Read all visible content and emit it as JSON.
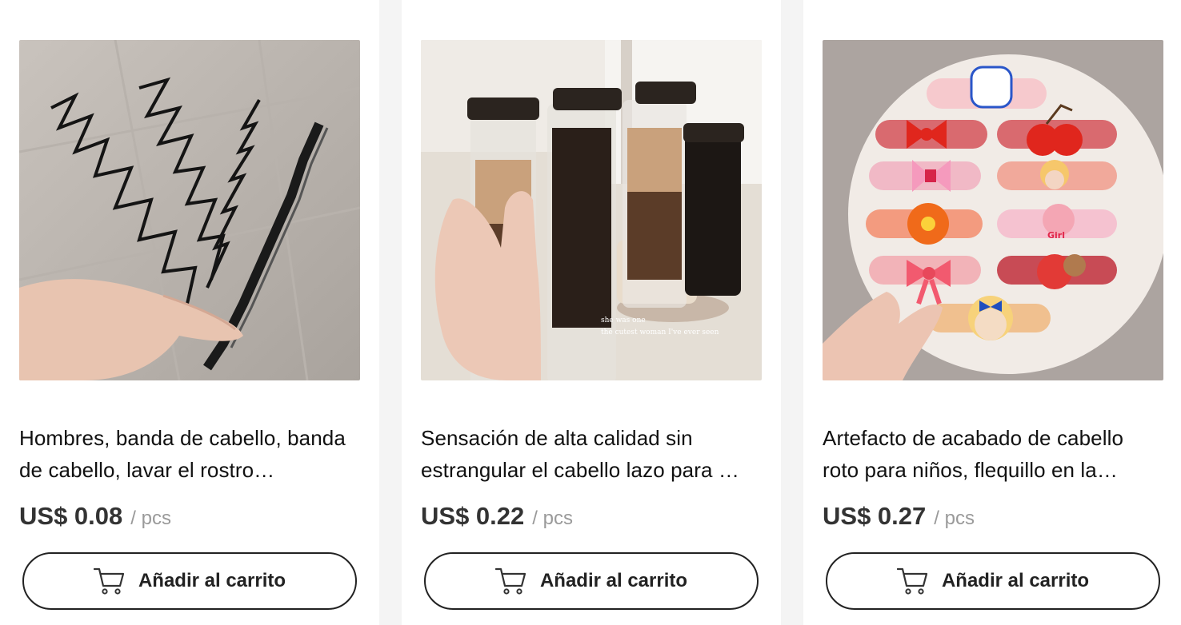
{
  "products": [
    {
      "title": "Hombres, banda de cabello, banda de cabello, lavar el rostro…",
      "price": "US$ 0.08",
      "unit": "/ pcs",
      "cart_label": "Añadir al carrito",
      "image_caption": ""
    },
    {
      "title": "Sensación de alta calidad sin estrangular el cabello lazo para …",
      "price": "US$ 0.22",
      "unit": "/ pcs",
      "cart_label": "Añadir al carrito",
      "image_caption_line1": "she was one",
      "image_caption_line2": "the cutest woman    I've ever seen"
    },
    {
      "title": "Artefacto de acabado de cabello roto para niños, flequillo en la…",
      "price": "US$ 0.27",
      "unit": "/ pcs",
      "cart_label": "Añadir al carrito",
      "image_badge": "Girl"
    }
  ],
  "colors": {
    "page_background": "#f4f4f4",
    "card_background": "#ffffff",
    "price_text": "#333333",
    "unit_text": "#9a9a9a",
    "button_border": "#222222"
  },
  "icons": {
    "cart": "shopping-cart-icon"
  }
}
